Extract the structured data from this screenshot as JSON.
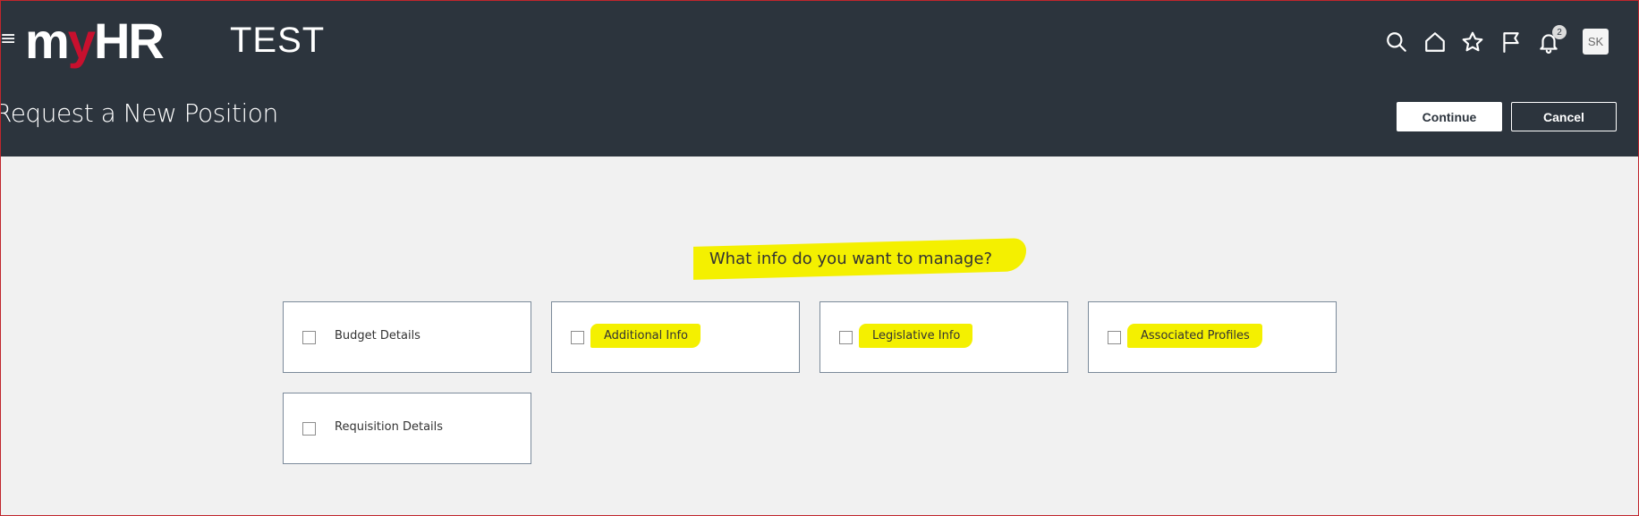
{
  "header": {
    "menu_icon": "hamburger-icon",
    "logo": {
      "part_m": "m",
      "part_y": "y",
      "part_hr": "HR"
    },
    "environment_label": "TEST",
    "icons": {
      "search": "search-icon",
      "home": "home-icon",
      "favorites": "star-icon",
      "flag": "flag-icon",
      "notifications": "bell-icon"
    },
    "notification_count": "2",
    "avatar_initials": "SK",
    "colors": {
      "background": "#2c343d",
      "logo_accent": "#c8102e"
    }
  },
  "page": {
    "title": "Request a New Position",
    "continue_label": "Continue",
    "cancel_label": "Cancel"
  },
  "main": {
    "question": "What info do you want to manage?",
    "options": [
      {
        "label": "Budget Details",
        "checked": false,
        "highlighted": false
      },
      {
        "label": "Additional Info",
        "checked": false,
        "highlighted": true
      },
      {
        "label": "Legislative Info",
        "checked": false,
        "highlighted": true
      },
      {
        "label": "Associated Profiles",
        "checked": false,
        "highlighted": true
      },
      {
        "label": "Requisition Details",
        "checked": false,
        "highlighted": false
      }
    ],
    "highlight_color": "#f4f000"
  }
}
